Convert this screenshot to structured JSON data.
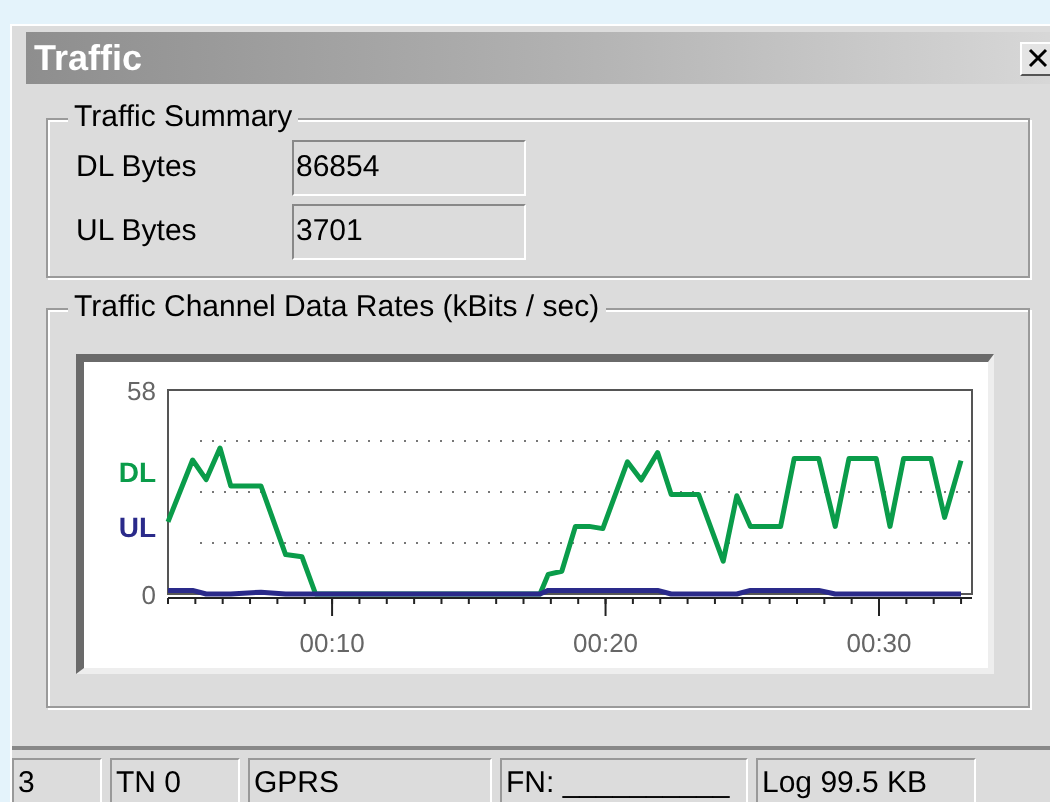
{
  "window": {
    "title": "Traffic"
  },
  "summary": {
    "title": "Traffic Summary",
    "fields": [
      {
        "label": "DL Bytes",
        "value": "86854"
      },
      {
        "label": "UL Bytes",
        "value": "3701"
      }
    ]
  },
  "rates": {
    "title": "Traffic Channel Data Rates (kBits / sec)",
    "chart_data": {
      "type": "line",
      "x": [
        4.0,
        4.9,
        5.4,
        5.9,
        6.3,
        7.4,
        8.3,
        8.9,
        9.4,
        17.6,
        17.9,
        18.4,
        18.9,
        19.4,
        19.9,
        20.8,
        21.3,
        21.9,
        22.4,
        23.4,
        24.3,
        24.8,
        25.3,
        26.4,
        26.9,
        27.8,
        28.4,
        28.9,
        29.9,
        30.4,
        30.9,
        31.9,
        32.4,
        33.0
      ],
      "series": [
        {
          "name": "DL",
          "color": "#0a9c4a",
          "values": [
            20.5,
            38.1,
            32.5,
            41.5,
            30.7,
            30.7,
            11.2,
            10.6,
            0,
            0,
            5.6,
            6.5,
            19.2,
            19.2,
            18.6,
            37.6,
            32.4,
            40.2,
            28.3,
            28.3,
            9.3,
            27.9,
            19.2,
            19.2,
            38.5,
            38.5,
            19.2,
            38.5,
            38.5,
            19.2,
            38.5,
            38.5,
            21.8,
            37.9
          ]
        },
        {
          "name": "UL",
          "color": "#2a2a8a",
          "values": [
            1,
            1,
            0,
            0,
            0,
            0.5,
            0,
            0,
            0,
            0,
            1,
            1,
            1,
            1,
            1,
            1,
            1,
            1,
            0,
            0,
            0,
            0,
            1,
            1,
            1,
            1,
            0,
            0,
            0,
            0,
            0,
            0,
            0,
            0
          ]
        }
      ],
      "xlim": [
        4,
        33.4
      ],
      "ylim": [
        0,
        58
      ],
      "xticks": [
        {
          "value": 10,
          "label": "00:10"
        },
        {
          "value": 20,
          "label": "00:20"
        },
        {
          "value": 30,
          "label": "00:30"
        }
      ],
      "yticks": [
        0,
        58
      ]
    }
  },
  "status_bar": [
    "3",
    "TN 0",
    "GPRS",
    "FN: __________",
    "Log 99.5 KB"
  ]
}
